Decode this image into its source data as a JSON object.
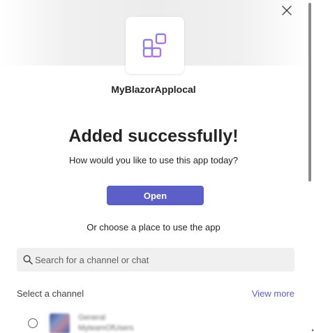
{
  "dialog": {
    "close_icon": "close-icon",
    "app_icon": "apps-grid-icon",
    "app_name": "MyBlazorApplocal",
    "headline": "Added successfully!",
    "subtext": "How would you like to use this app today?",
    "open_label": "Open",
    "alt_text": "Or choose a place to use the app",
    "search": {
      "placeholder": "Search for a channel or chat",
      "value": "",
      "icon": "search-icon"
    },
    "section_label": "Select a channel",
    "view_more_label": "View more",
    "channels": [
      {
        "title": "General",
        "subtitle": "MyteamOfUsers",
        "selected": false
      }
    ]
  },
  "colors": {
    "brand": "#5b5fc7",
    "text": "#242424",
    "search_bg": "#f0f0f0"
  }
}
